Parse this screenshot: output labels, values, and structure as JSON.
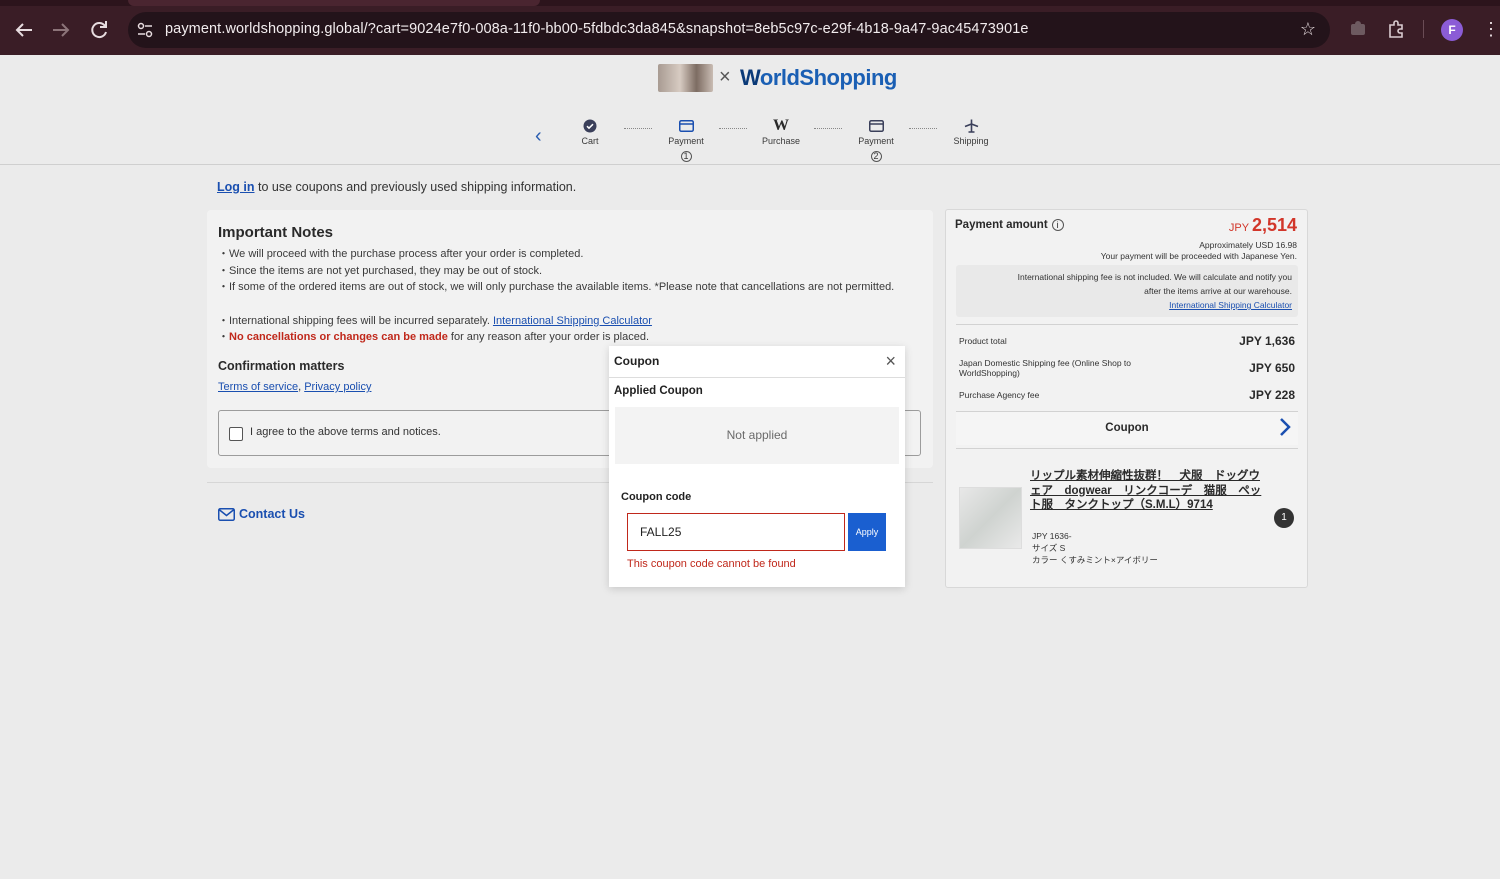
{
  "browser": {
    "url": "payment.worldshopping.global/?cart=9024e7f0-008a-11f0-bb00-5fdbdc3da845&snapshot=8eb5c97c-e29f-4b18-9a47-9ac45473901e",
    "profile_initial": "F"
  },
  "header": {
    "logo_text_w": "W",
    "logo_text_rest": "orldShopping",
    "logo_x": "×",
    "steps": [
      {
        "label": "Cart",
        "icon": "check-circle-icon"
      },
      {
        "label": "Payment",
        "num": "1",
        "icon": "card-icon"
      },
      {
        "label": "Purchase",
        "icon": "w-logo-icon"
      },
      {
        "label": "Payment",
        "num": "2",
        "icon": "card-icon"
      },
      {
        "label": "Shipping",
        "icon": "airplane-icon"
      }
    ]
  },
  "login": {
    "link": "Log in",
    "text": " to use coupons and previously used shipping information."
  },
  "notes": {
    "title": "Important Notes",
    "items": [
      "・We will proceed with the purchase process after your order is completed.",
      "・Since the items are not yet purchased, they may be out of stock.",
      "・If some of the ordered items are out of stock, we will only purchase the available items. *Please note that cancellations are not permitted.",
      "・International shipping fees will be incurred separately. ",
      "International Shipping Calculator",
      "・",
      "No cancellations or changes can be made",
      " for any reason after your order is placed."
    ],
    "confirmation_title": "Confirmation matters",
    "terms": "Terms of service",
    "comma": ", ",
    "privacy": "Privacy policy",
    "agree": "I agree to the above terms and notices."
  },
  "contact": "Contact Us",
  "summary": {
    "payment_amount_label": "Payment amount",
    "info": "i",
    "currency": "JPY ",
    "amount": "2,514",
    "approx": "Approximately USD 16.98",
    "yen_note": "Your payment will be proceeded with Japanese Yen.",
    "intl_note_1": "International shipping fee is not included. We will calculate and notify you",
    "intl_note_2": "after the items arrive at our warehouse.",
    "intl_link": "International Shipping Calculator",
    "rows": [
      {
        "k": "Product total",
        "v": "JPY 1,636"
      },
      {
        "k": "Japan Domestic Shipping fee (Online Shop to WorldShopping)",
        "v": "JPY 650"
      },
      {
        "k": "Purchase Agency fee",
        "v": "JPY 228"
      }
    ],
    "coupon": "Coupon",
    "item": {
      "title": "リップル素材伸縮性抜群！　犬服　ドッグウェア　dogwear　リンクコーデ　猫服　ペット服　タンクトップ（S.M.L）9714",
      "price": "JPY 1636-",
      "size": "サイズ S",
      "color": "カラー くすみミント×アイボリー",
      "qty": "1"
    }
  },
  "modal": {
    "title": "Coupon",
    "close": "×",
    "applied_label": "Applied Coupon",
    "not_applied": "Not applied",
    "code_label": "Coupon code",
    "code_value": "FALL25",
    "apply": "Apply",
    "error": "This coupon code cannot be found"
  },
  "colors": {
    "accent": "#1a5fd0",
    "error": "#c0281b",
    "chrome": "#3a1d26"
  }
}
